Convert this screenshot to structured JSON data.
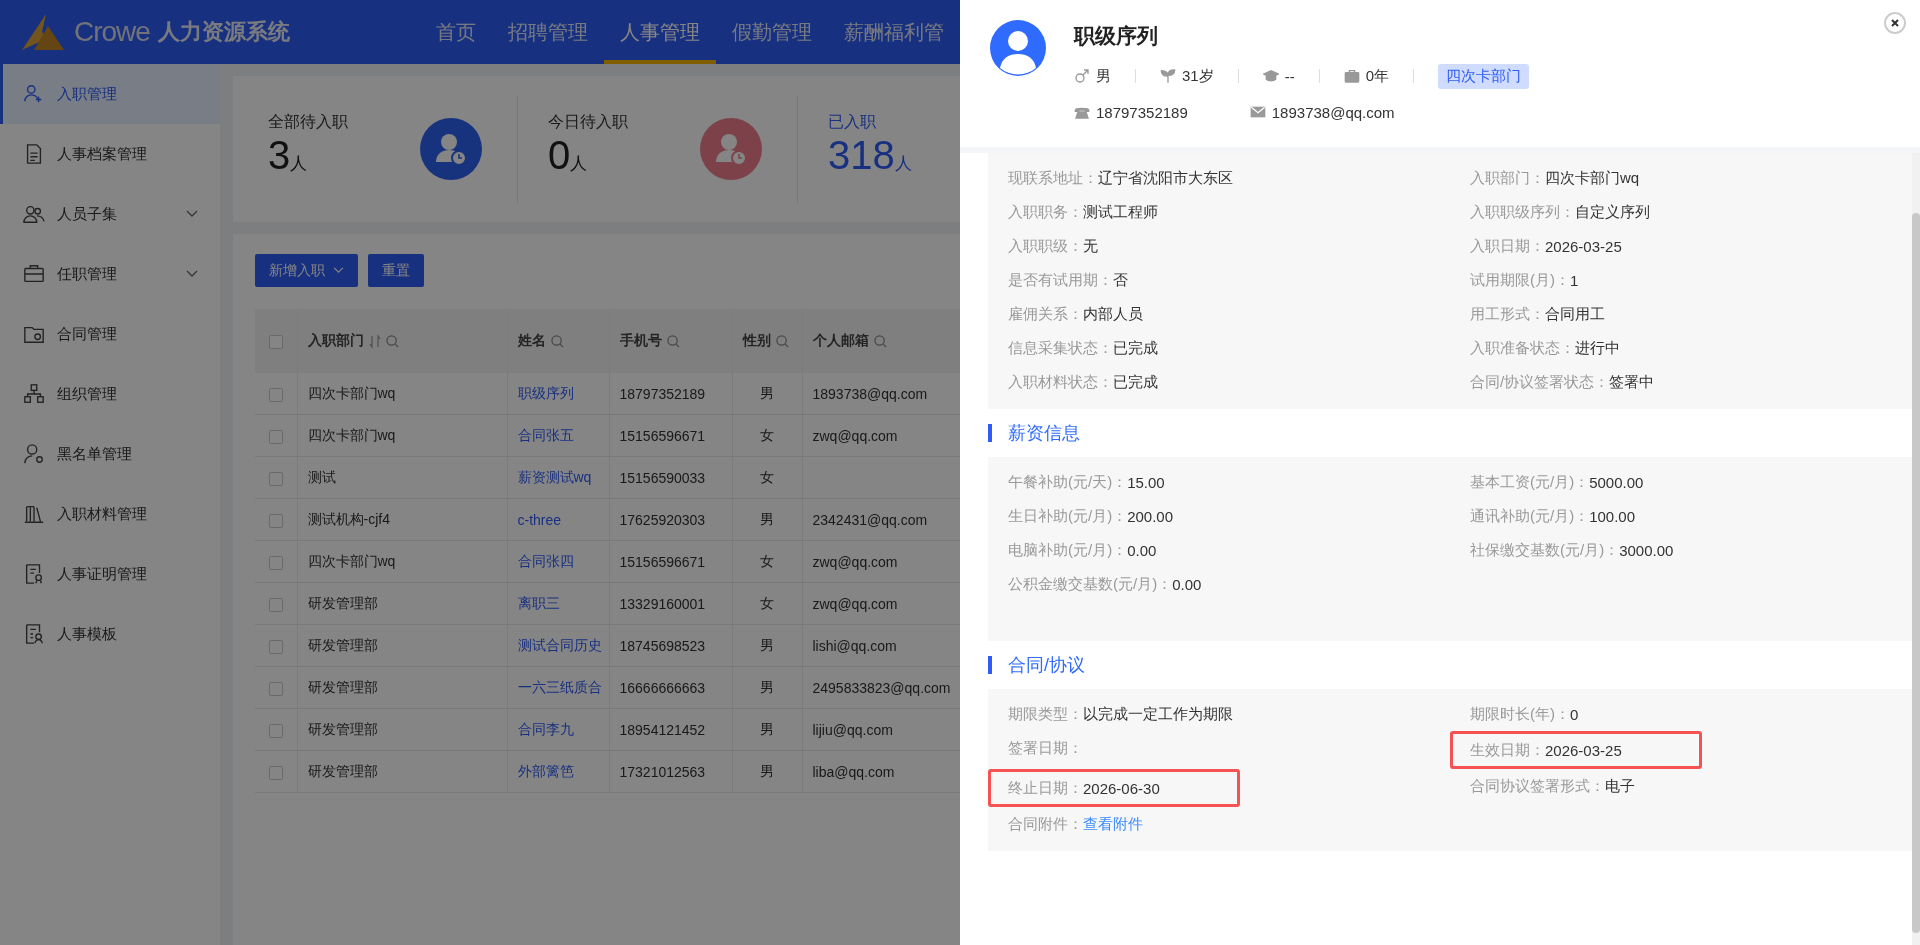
{
  "header": {
    "logo_text": "Crowe",
    "system_name": "人力资源系统",
    "nav": [
      {
        "label": "首页",
        "selected": false
      },
      {
        "label": "招聘管理",
        "selected": false
      },
      {
        "label": "人事管理",
        "selected": true
      },
      {
        "label": "假勤管理",
        "selected": false
      },
      {
        "label": "薪酬福利管",
        "selected": false
      }
    ]
  },
  "sidebar": {
    "items": [
      {
        "label": "入职管理",
        "selected": true,
        "expandable": false
      },
      {
        "label": "人事档案管理",
        "selected": false,
        "expandable": false
      },
      {
        "label": "人员子集",
        "selected": false,
        "expandable": true
      },
      {
        "label": "任职管理",
        "selected": false,
        "expandable": true
      },
      {
        "label": "合同管理",
        "selected": false,
        "expandable": false
      },
      {
        "label": "组织管理",
        "selected": false,
        "expandable": false
      },
      {
        "label": "黑名单管理",
        "selected": false,
        "expandable": false
      },
      {
        "label": "入职材料管理",
        "selected": false,
        "expandable": false
      },
      {
        "label": "人事证明管理",
        "selected": false,
        "expandable": false
      },
      {
        "label": "人事模板",
        "selected": false,
        "expandable": false
      }
    ]
  },
  "stats": [
    {
      "label": "全部待入职",
      "value": "3",
      "unit": "人",
      "selected": false
    },
    {
      "label": "今日待入职",
      "value": "0",
      "unit": "人",
      "selected": false
    },
    {
      "label": "已入职",
      "value": "318",
      "unit": "人",
      "selected": true
    }
  ],
  "toolbar": {
    "buttons": [
      {
        "label": "新增入职",
        "dropdown": true
      },
      {
        "label": "重置",
        "dropdown": false
      }
    ]
  },
  "table": {
    "all_checked": false,
    "columns": [
      {
        "label": "入职部门",
        "sortable": true
      },
      {
        "label": "姓名",
        "sortable": false
      },
      {
        "label": "手机号",
        "sortable": false
      },
      {
        "label": "性别",
        "sortable": false
      },
      {
        "label": "个人邮箱",
        "sortable": false
      }
    ],
    "rows": [
      {
        "checked": false,
        "cells": [
          "四次卡部门wq",
          "职级序列",
          "18797352189",
          "男",
          "1893738@qq.com"
        ]
      },
      {
        "checked": false,
        "cells": [
          "四次卡部门wq",
          "合同张五",
          "15156596671",
          "女",
          "zwq@qq.com"
        ]
      },
      {
        "checked": false,
        "cells": [
          "测试",
          "薪资测试wq",
          "15156590033",
          "女",
          ""
        ]
      },
      {
        "checked": false,
        "cells": [
          "测试机构-cjf4",
          "c-three",
          "17625920303",
          "男",
          "2342431@qq.com"
        ]
      },
      {
        "checked": false,
        "cells": [
          "四次卡部门wq",
          "合同张四",
          "15156596671",
          "女",
          "zwq@qq.com"
        ]
      },
      {
        "checked": false,
        "cells": [
          "研发管理部",
          "离职三",
          "13329160001",
          "女",
          "zwq@qq.com"
        ]
      },
      {
        "checked": false,
        "cells": [
          "研发管理部",
          "测试合同历史",
          "18745698523",
          "男",
          "lishi@qq.com"
        ]
      },
      {
        "checked": false,
        "cells": [
          "研发管理部",
          "一六三纸质合",
          "16666666663",
          "男",
          "2495833823@qq.com"
        ]
      },
      {
        "checked": false,
        "cells": [
          "研发管理部",
          "合同李九",
          "18954121452",
          "男",
          "lijiu@qq.com"
        ]
      },
      {
        "checked": false,
        "cells": [
          "研发管理部",
          "外部篱笆",
          "17321012563",
          "男",
          "liba@qq.com"
        ]
      }
    ]
  },
  "drawer": {
    "name": "职级序列",
    "gender": "男",
    "age": "31岁",
    "education": "--",
    "experience": "0年",
    "department_tag": "四次卡部门",
    "phone": "18797352189",
    "email": "1893738@qq.com",
    "sections": [
      {
        "fields": [
          {
            "label": "现联系地址：",
            "value": "辽宁省沈阳市大东区",
            "highlighted": false
          },
          {
            "label": "入职部门：",
            "value": "四次卡部门wq",
            "highlighted": false
          },
          {
            "label": "入职职务：",
            "value": "测试工程师",
            "highlighted": false
          },
          {
            "label": "入职职级序列：",
            "value": "自定义序列",
            "highlighted": false
          },
          {
            "label": "入职职级：",
            "value": "无",
            "highlighted": false
          },
          {
            "label": "入职日期：",
            "value": "2026-03-25",
            "highlighted": false
          },
          {
            "label": "是否有试用期：",
            "value": "否",
            "highlighted": false
          },
          {
            "label": "试用期限(月)：",
            "value": "1",
            "highlighted": false
          },
          {
            "label": "雇佣关系：",
            "value": "内部人员",
            "highlighted": false
          },
          {
            "label": "用工形式：",
            "value": "合同用工",
            "highlighted": false
          },
          {
            "label": "信息采集状态：",
            "value": "已完成",
            "highlighted": false
          },
          {
            "label": "入职准备状态：",
            "value": "进行中",
            "highlighted": false
          },
          {
            "label": "入职材料状态：",
            "value": "已完成",
            "highlighted": false
          },
          {
            "label": "合同/协议签署状态：",
            "value": "签署中",
            "highlighted": false
          }
        ]
      },
      {
        "title": "薪资信息",
        "fields": [
          {
            "label": "午餐补助(元/天)：",
            "value": "15.00",
            "highlighted": false
          },
          {
            "label": "基本工资(元/月)：",
            "value": "5000.00",
            "highlighted": false
          },
          {
            "label": "生日补助(元/月)：",
            "value": "200.00",
            "highlighted": false
          },
          {
            "label": "通讯补助(元/月)：",
            "value": "100.00",
            "highlighted": false
          },
          {
            "label": "电脑补助(元/月)：",
            "value": "0.00",
            "highlighted": false
          },
          {
            "label": "社保缴交基数(元/月)：",
            "value": "3000.00",
            "highlighted": false
          },
          {
            "label": "公积金缴交基数(元/月)：",
            "value": "0.00",
            "highlighted": false
          }
        ]
      },
      {
        "title": "合同/协议",
        "fields": [
          {
            "label": "期限类型：",
            "value": "以完成一定工作为期限",
            "highlighted": false
          },
          {
            "label": "期限时长(年)：",
            "value": "0",
            "highlighted": false
          },
          {
            "label": "签署日期：",
            "highlighted": false
          },
          {
            "label": "生效日期：",
            "value": "2026-03-25",
            "highlighted": true
          },
          {
            "label": "终止日期：",
            "value": "2026-06-30",
            "highlighted": true
          },
          {
            "label": "合同协议签署形式：",
            "value": "电子",
            "highlighted": false
          },
          {
            "label": "合同附件：",
            "value": "查看附件",
            "kind": "link",
            "highlighted": false
          }
        ]
      }
    ]
  }
}
